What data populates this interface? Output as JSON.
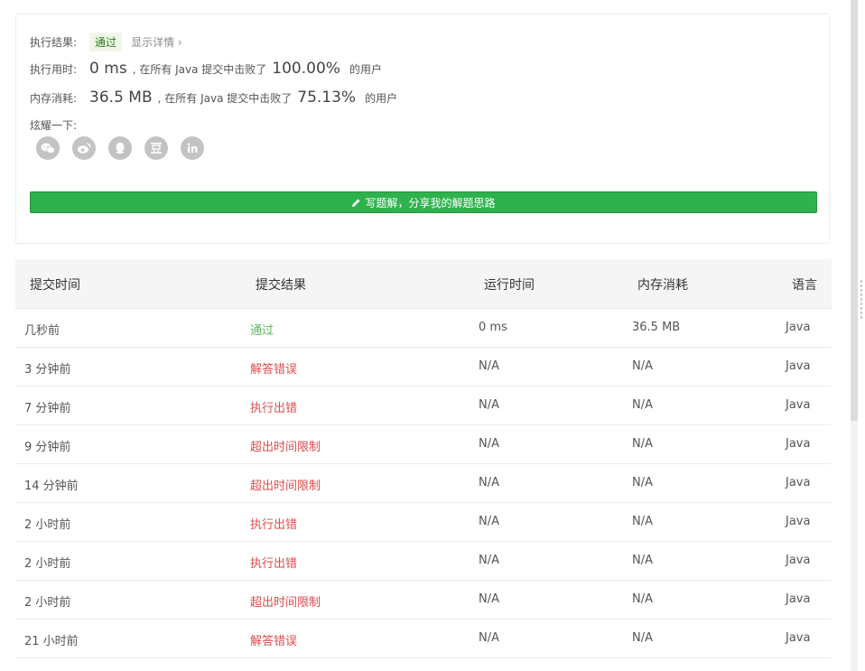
{
  "result": {
    "exec_result_label": "执行结果:",
    "exec_result_value": "通过",
    "show_details": "显示详情 ›",
    "time_label": "执行用时:",
    "time_value": "0 ms",
    "time_mid": ", 在所有 Java 提交中击败了",
    "time_pct": "100.00%",
    "time_tail": "的用户",
    "mem_label": "内存消耗:",
    "mem_value": "36.5 MB",
    "mem_mid": ", 在所有 Java 提交中击败了",
    "mem_pct": "75.13%",
    "mem_tail": "的用户",
    "share_label": "炫耀一下:",
    "share_icons": [
      "wechat-icon",
      "weibo-icon",
      "qq-icon",
      "douban-icon",
      "linkedin-icon"
    ],
    "write_solution_button": "写题解，分享我的解题思路"
  },
  "table": {
    "headers": [
      "提交时间",
      "提交结果",
      "运行时间",
      "内存消耗",
      "语言"
    ],
    "rows": [
      {
        "time": "几秒前",
        "status": "通过",
        "runtime": "0 ms",
        "memory": "36.5 MB",
        "lang": "Java"
      },
      {
        "time": "3 分钟前",
        "status": "解答错误",
        "runtime": "N/A",
        "memory": "N/A",
        "lang": "Java"
      },
      {
        "time": "7 分钟前",
        "status": "执行出错",
        "runtime": "N/A",
        "memory": "N/A",
        "lang": "Java"
      },
      {
        "time": "9 分钟前",
        "status": "超出时间限制",
        "runtime": "N/A",
        "memory": "N/A",
        "lang": "Java"
      },
      {
        "time": "14 分钟前",
        "status": "超出时间限制",
        "runtime": "N/A",
        "memory": "N/A",
        "lang": "Java"
      },
      {
        "time": "2 小时前",
        "status": "执行出错",
        "runtime": "N/A",
        "memory": "N/A",
        "lang": "Java"
      },
      {
        "time": "2 小时前",
        "status": "执行出错",
        "runtime": "N/A",
        "memory": "N/A",
        "lang": "Java"
      },
      {
        "time": "2 小时前",
        "status": "超出时间限制",
        "runtime": "N/A",
        "memory": "N/A",
        "lang": "Java"
      },
      {
        "time": "21 小时前",
        "status": "解答错误",
        "runtime": "N/A",
        "memory": "N/A",
        "lang": "Java"
      }
    ]
  },
  "colors": {
    "accept": "#5cb85c",
    "error": "#e04b4b",
    "button": "#2fb24e"
  }
}
